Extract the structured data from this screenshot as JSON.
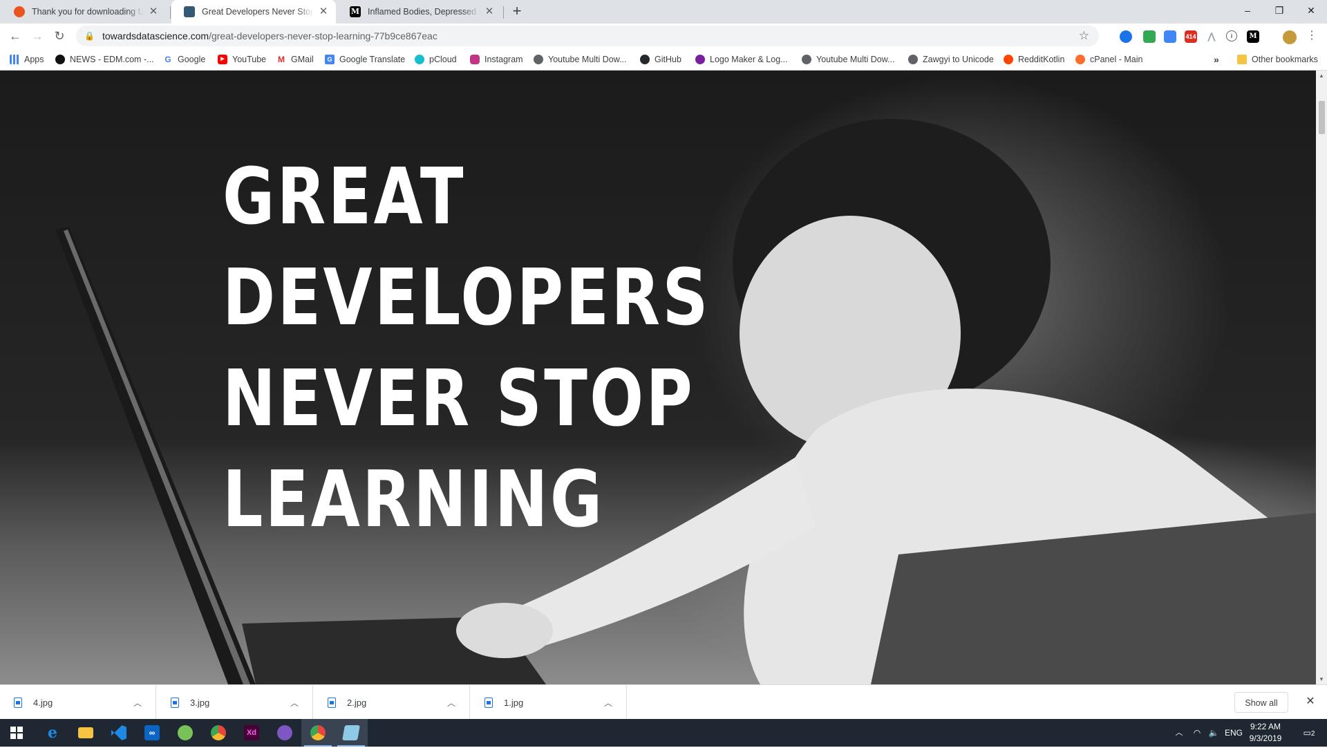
{
  "browser": {
    "tabs": [
      {
        "title": "Thank you for downloading Ubuntu",
        "icon": "ubuntu-icon",
        "active": false
      },
      {
        "title": "Great Developers Never Stop Learning",
        "icon": "tds-icon",
        "active": true
      },
      {
        "title": "Inflamed Bodies, Depressed Minds",
        "icon": "medium-icon",
        "active": false
      }
    ],
    "new_tab_label": "+",
    "window_controls": {
      "minimize": "–",
      "maximize": "❐",
      "close": "✕"
    },
    "url": {
      "host": "towardsdatascience.com",
      "path": "/great-developers-never-stop-learning-77b9ce867eac"
    },
    "extensions": [
      {
        "name": "google-earth-icon",
        "color": "#1a73e8",
        "label": ""
      },
      {
        "name": "onenote-clipper-icon",
        "color": "#34a853",
        "label": ""
      },
      {
        "name": "translate-icon",
        "color": "#4285f4",
        "label": ""
      },
      {
        "name": "gmail-checker-icon",
        "color": "#d93025",
        "label": "414"
      },
      {
        "name": "extension-a-icon",
        "color": "#9aa0a6",
        "label": ""
      },
      {
        "name": "extension-i-icon",
        "color": "#5f6368",
        "label": ""
      },
      {
        "name": "medium-icon",
        "color": "#000000",
        "label": "M"
      },
      {
        "name": "profile-avatar",
        "color": "#c49a3a",
        "label": ""
      }
    ]
  },
  "bookmarks": [
    {
      "label": "Apps",
      "icon": "apps-grid-icon",
      "color": "#4285f4"
    },
    {
      "label": "NEWS - EDM.com -...",
      "icon": "edm-icon",
      "color": "#111111"
    },
    {
      "label": "Google",
      "icon": "google-icon",
      "color": "#4285f4"
    },
    {
      "label": "YouTube",
      "icon": "youtube-icon",
      "color": "#ff0000"
    },
    {
      "label": "GMail",
      "icon": "gmail-icon",
      "color": "#d93025"
    },
    {
      "label": "Google Translate",
      "icon": "translate-icon",
      "color": "#4285f4"
    },
    {
      "label": "pCloud",
      "icon": "pcloud-icon",
      "color": "#17bed0"
    },
    {
      "label": "Instagram",
      "icon": "instagram-icon",
      "color": "#c13584"
    },
    {
      "label": "Youtube Multi Dow...",
      "icon": "globe-icon",
      "color": "#5f6368"
    },
    {
      "label": "GitHub",
      "icon": "github-icon",
      "color": "#24292e"
    },
    {
      "label": "Logo Maker & Log...",
      "icon": "logomaker-icon",
      "color": "#7b1fa2"
    },
    {
      "label": "Youtube Multi Dow...",
      "icon": "globe-icon",
      "color": "#5f6368"
    },
    {
      "label": "Zawgyi to Unicode",
      "icon": "globe-icon",
      "color": "#5f6368"
    },
    {
      "label": "RedditKotlin",
      "icon": "reddit-icon",
      "color": "#ff4500"
    },
    {
      "label": "cPanel - Main",
      "icon": "cpanel-icon",
      "color": "#ff6c2c"
    }
  ],
  "bookmarks_overflow": "»",
  "other_bookmarks": "Other bookmarks",
  "page": {
    "headline_lines": [
      "GREAT",
      "DEVELOPERS",
      "NEVER STOP",
      "LEARNING"
    ]
  },
  "downloads": [
    {
      "file": "4.jpg"
    },
    {
      "file": "3.jpg"
    },
    {
      "file": "2.jpg"
    },
    {
      "file": "1.jpg"
    }
  ],
  "show_all_label": "Show all",
  "taskbar": {
    "apps": [
      {
        "name": "start-icon",
        "label": "",
        "color": "#ffffff",
        "active": false
      },
      {
        "name": "edge-icon",
        "label": "e",
        "color": "#1e88e5",
        "active": false
      },
      {
        "name": "file-explorer-icon",
        "label": "",
        "color": "#f6c343",
        "active": false
      },
      {
        "name": "vscode-icon",
        "label": "",
        "color": "#1e88e5",
        "active": false
      },
      {
        "name": "app-infinity-icon",
        "label": "∞",
        "color": "#0a66c2",
        "active": false
      },
      {
        "name": "android-studio-icon",
        "label": "",
        "color": "#78c257",
        "active": false
      },
      {
        "name": "chrome-icon",
        "label": "",
        "color": "#e8453c",
        "active": false
      },
      {
        "name": "adobe-xd-icon",
        "label": "Xd",
        "color": "#470137",
        "active": false
      },
      {
        "name": "podcast-app-icon",
        "label": "",
        "color": "#7e57c2",
        "active": false
      },
      {
        "name": "chrome-active-icon",
        "label": "",
        "color": "#e8453c",
        "active": true
      },
      {
        "name": "notepad-icon",
        "label": "",
        "color": "#8ecae6",
        "active": true
      }
    ],
    "tray": {
      "language": "ENG",
      "time": "9:22 AM",
      "date": "9/3/2019",
      "notifications": "2"
    }
  }
}
